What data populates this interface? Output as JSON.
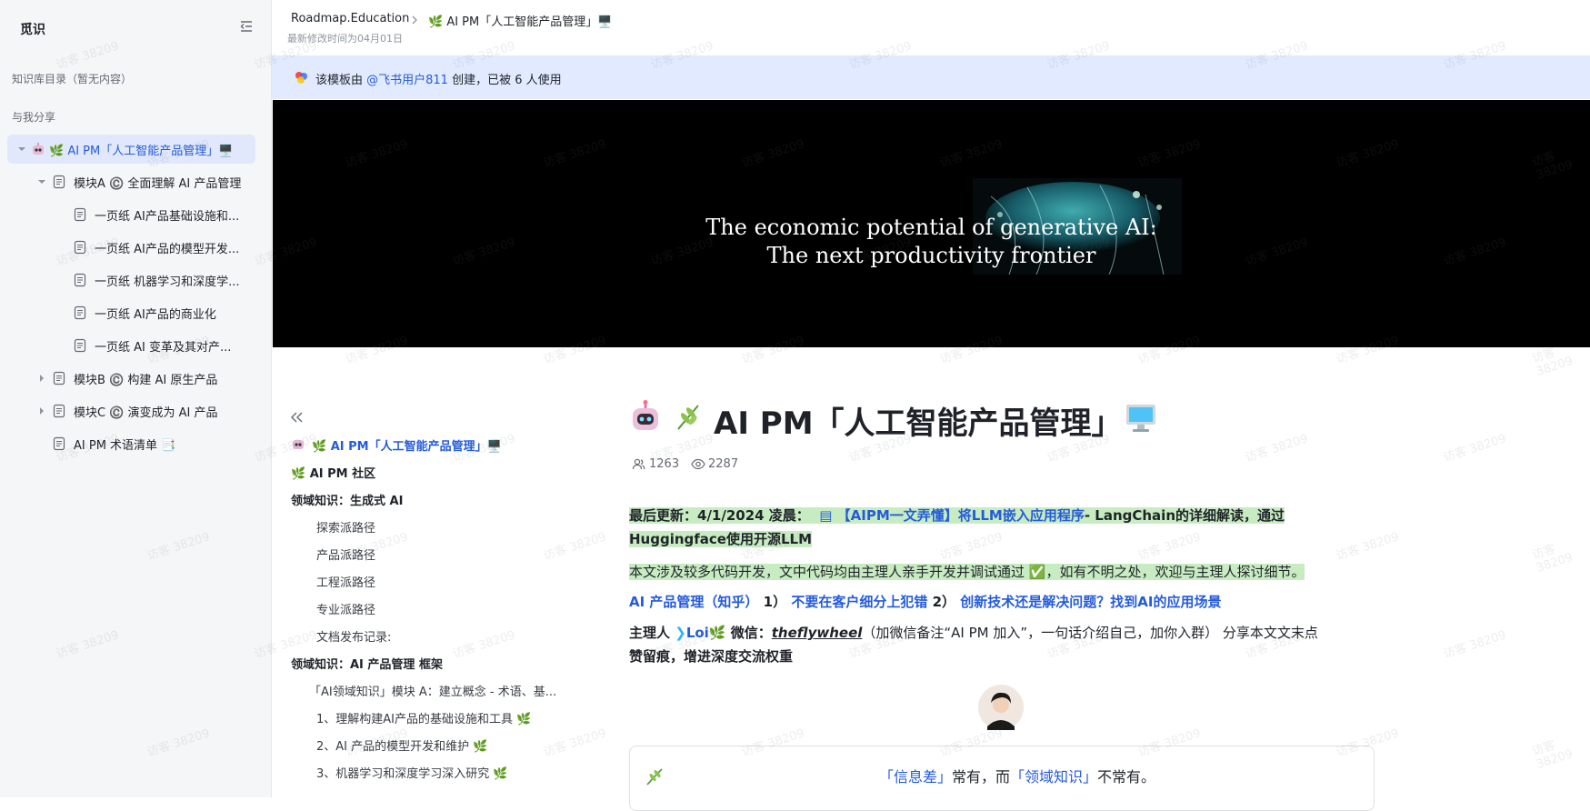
{
  "sidebar": {
    "title": "觅识",
    "section_catalog": "知识库目录（暂无内容）",
    "section_shared": "与我分享",
    "tree": [
      {
        "label": "🌿 AI PM「人工智能产品管理」🖥️",
        "active": true
      },
      {
        "label": "模块A ©️ 全面理解 AI 产品管理"
      },
      {
        "label": "一页纸 AI产品基础设施和..."
      },
      {
        "label": "一页纸 AI产品的模型开发..."
      },
      {
        "label": "一页纸 机器学习和深度学..."
      },
      {
        "label": "一页纸 AI产品的商业化"
      },
      {
        "label": "一页纸 AI 变革及其对产..."
      },
      {
        "label": "模块B ©️ 构建 AI 原生产品"
      },
      {
        "label": "模块C ©️ 演变成为 AI 产品"
      },
      {
        "label": "AI PM 术语清单 📑"
      }
    ]
  },
  "header": {
    "breadcrumb_root": "Roadmap.Education",
    "breadcrumb_current": "🌿 AI PM「人工智能产品管理」🖥️",
    "modified": "最新修改时间为04月01日"
  },
  "notice": {
    "prefix": "该模板由 ",
    "user": "@飞书用户811",
    "suffix": " 创建，已被 6 人使用"
  },
  "banner": {
    "line1": "The economic potential of generative AI:",
    "line2": "The next productivity frontier"
  },
  "toc": [
    {
      "label": "🌿 AI PM「人工智能产品管理」🖥️",
      "kind": "active"
    },
    {
      "label": "🌿 AI PM 社区",
      "kind": "bold"
    },
    {
      "label": "领域知识：生成式 AI",
      "kind": "bold"
    },
    {
      "label": "探索派路径",
      "kind": "sub"
    },
    {
      "label": "产品派路径",
      "kind": "sub"
    },
    {
      "label": "工程派路径",
      "kind": "sub"
    },
    {
      "label": "专业派路径",
      "kind": "sub"
    },
    {
      "label": "文档发布记录:",
      "kind": "sub"
    },
    {
      "label": "领域知识：AI 产品管理 框架",
      "kind": "bold"
    },
    {
      "label": "「AI领域知识」模块 A：建立概念 - 术语、基...",
      "kind": "sub"
    },
    {
      "label": "1、理解构建AI产品的基础设施和工具 🌿",
      "kind": "sub"
    },
    {
      "label": "2、AI 产品的模型开发和维护 🌿",
      "kind": "sub"
    },
    {
      "label": "3、机器学习和深度学习深入研究 🌿",
      "kind": "sub"
    }
  ],
  "doc": {
    "title": "AI PM「人工智能产品管理」",
    "members": "1263",
    "views": "2287",
    "update_prefix": "最后更新：4/1/2024 凌晨：",
    "update_link": "【AIPM一文弄懂】将LLM嵌入应用程序",
    "update_suffix": "- LangChain的详细解读，通过",
    "update_line2": "Huggingface使用开源LLM",
    "code_note": "本文涉及较多代码开发，文中代码均由主理人亲手开发并调试通过 ✅，如有不明之处，欢迎与主理人探讨细节。",
    "links_lead": "AI 产品管理（知乎）",
    "link1_num": "1）",
    "link1": "不要在客户细分上犯错",
    "link2_num": "2）",
    "link2": "创新技术还是解决问题？找到AI的应用场景",
    "host_prefix": "主理人 ",
    "host_name": "Loi",
    "wechat_label": " 微信：",
    "wechat_id": "theflywheel",
    "host_suffix": "（加微信备注“AI PM 加入”，一句话介绍自己，加你入群） 分享本文文末点",
    "host_line2": "赞留痕，增进深度交流权重",
    "callout_part1": "「信息差」",
    "callout_part2": "常有，而",
    "callout_part3": "「领域知识」",
    "callout_part4": "不常有。"
  },
  "watermark": "访客 38209",
  "colors": {
    "accent": "#245bdb",
    "highlight": "#c8ecc1",
    "notice_bg": "#e1eaff"
  }
}
